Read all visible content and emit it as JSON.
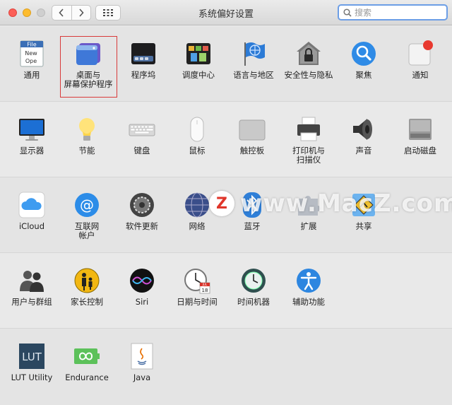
{
  "window": {
    "title": "系统偏好设置",
    "search_placeholder": "搜索"
  },
  "sections": [
    {
      "items": [
        {
          "label": "通用",
          "icon": "general-icon"
        },
        {
          "label": "桌面与\n屏幕保护程序",
          "icon": "desktop-screensaver-icon",
          "selected": true
        },
        {
          "label": "程序坞",
          "icon": "dock-icon"
        },
        {
          "label": "调度中心",
          "icon": "mission-control-icon"
        },
        {
          "label": "语言与地区",
          "icon": "language-region-icon"
        },
        {
          "label": "安全性与隐私",
          "icon": "security-privacy-icon"
        },
        {
          "label": "聚焦",
          "icon": "spotlight-icon"
        },
        {
          "label": "通知",
          "icon": "notifications-icon"
        }
      ]
    },
    {
      "items": [
        {
          "label": "显示器",
          "icon": "displays-icon"
        },
        {
          "label": "节能",
          "icon": "energy-saver-icon"
        },
        {
          "label": "键盘",
          "icon": "keyboard-icon"
        },
        {
          "label": "鼠标",
          "icon": "mouse-icon"
        },
        {
          "label": "触控板",
          "icon": "trackpad-icon"
        },
        {
          "label": "打印机与\n扫描仪",
          "icon": "printers-scanners-icon"
        },
        {
          "label": "声音",
          "icon": "sound-icon"
        },
        {
          "label": "启动磁盘",
          "icon": "startup-disk-icon"
        }
      ]
    },
    {
      "items": [
        {
          "label": "iCloud",
          "icon": "icloud-icon"
        },
        {
          "label": "互联网\n帐户",
          "icon": "internet-accounts-icon"
        },
        {
          "label": "软件更新",
          "icon": "software-update-icon"
        },
        {
          "label": "网络",
          "icon": "network-icon"
        },
        {
          "label": "蓝牙",
          "icon": "bluetooth-icon"
        },
        {
          "label": "扩展",
          "icon": "extensions-icon"
        },
        {
          "label": "共享",
          "icon": "sharing-icon"
        }
      ]
    },
    {
      "items": [
        {
          "label": "用户与群组",
          "icon": "users-groups-icon"
        },
        {
          "label": "家长控制",
          "icon": "parental-controls-icon"
        },
        {
          "label": "Siri",
          "icon": "siri-icon"
        },
        {
          "label": "日期与时间",
          "icon": "date-time-icon"
        },
        {
          "label": "时间机器",
          "icon": "time-machine-icon"
        },
        {
          "label": "辅助功能",
          "icon": "accessibility-icon"
        }
      ]
    },
    {
      "items": [
        {
          "label": "LUT Utility",
          "icon": "lut-utility-icon"
        },
        {
          "label": "Endurance",
          "icon": "endurance-icon"
        },
        {
          "label": "Java",
          "icon": "java-icon"
        }
      ]
    }
  ],
  "icon_texts": {
    "general_file": "File",
    "general_new": "New",
    "general_open": "Ope",
    "calendar_month": "JUL",
    "calendar_day": "18",
    "lut": "LUT"
  },
  "watermark": {
    "badge": "Z",
    "text": "www.MacZ.com"
  }
}
